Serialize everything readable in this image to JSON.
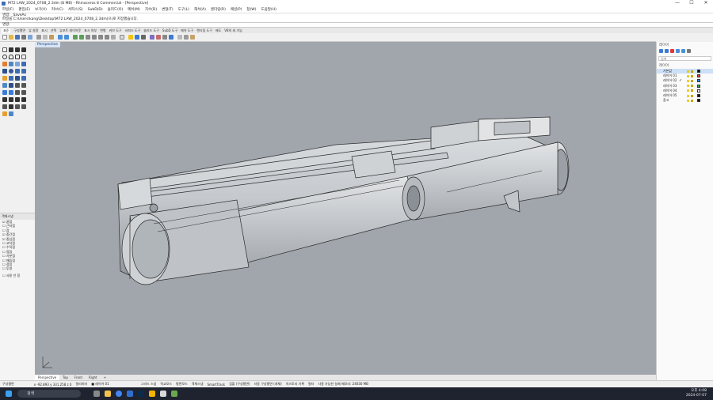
{
  "window": {
    "title": "M72 LAW_2024_0708_2.3dm (8 MB) - Rhinoceros 8 Commercial - [Perspective]",
    "controls": [
      "—",
      "☐",
      "✕"
    ]
  },
  "menu": [
    "파일(F)",
    "편집(E)",
    "보기(V)",
    "커브(C)",
    "서피스(S)",
    "SubD(D)",
    "솔리드(O)",
    "메쉬(M)",
    "치수(D)",
    "변형(T)",
    "도구(L)",
    "해석(A)",
    "렌더링(R)",
    "패널(P)",
    "창(W)",
    "도움말(H)"
  ],
  "command_history": [
    "명령: _SaveAs",
    "파일을 C:\\Users\\kang\\Desktop\\M72 LAW_2024_0708_2.3dm(으)로 저장했습니다."
  ],
  "command_prompt": "명령:",
  "toolbar_tabs": [
    "표준",
    "구성평면",
    "뷰 설정",
    "표시",
    "선택",
    "뷰포트 레이아웃",
    "표시 여부",
    "변형",
    "커브 도구",
    "서피스 도구",
    "솔리드 도구",
    "SubD 도구",
    "메쉬 도구",
    "렌더링 도구",
    "제도",
    "V8의 새 기능"
  ],
  "viewport": {
    "label": "Perspective",
    "bg_color": "#a1a6ad",
    "tabs": [
      "Perspective",
      "Top",
      "Front",
      "Right",
      "+"
    ],
    "active_tab": "Perspective"
  },
  "display_panel": {
    "title": "객체스냅",
    "items": [
      "끝점",
      "근처점",
      "점",
      "중간점",
      "중심점",
      "교차점",
      "수직점",
      "접점",
      "사분점",
      "매듭점",
      "정점",
      "투영"
    ],
    "checked": [
      0,
      3,
      4
    ],
    "footer": "사용 안 함"
  },
  "layers_panel": {
    "title": "레이어",
    "search_placeholder": "검색",
    "column": "레이어",
    "layers": [
      {
        "name": "기본값",
        "current": true,
        "color": "#000000"
      },
      {
        "name": "레이어 01",
        "current": false,
        "color": "#e53935"
      },
      {
        "name": "레이어 02",
        "current": false,
        "color": "#1e88e5",
        "check": "✓"
      },
      {
        "name": "레이어 03",
        "current": false,
        "color": "#43a047"
      },
      {
        "name": "레이어 04",
        "current": false,
        "color": "#ffffff"
      },
      {
        "name": "레이어 05",
        "current": false,
        "color": "#111111"
      },
      {
        "name": "참고",
        "current": false,
        "color": "#111111"
      }
    ]
  },
  "statusbar": {
    "items": [
      "구성평면",
      "x -92.893  y 331.258  z 0",
      "밀리미터",
      "■ 레이어 01",
      "그리드 스냅",
      "직교모드",
      "평면모드",
      "객체스냅",
      "SmartTrack",
      "검볼 (구성평면)",
      "자동 구성평면 (개체)",
      "히스토리 기록",
      "필터",
      "사용 가능한 실제 메모리: 24030 MB"
    ]
  },
  "taskbar": {
    "search": "검색",
    "time": "오후 4:08",
    "date": "2024-07-07"
  }
}
